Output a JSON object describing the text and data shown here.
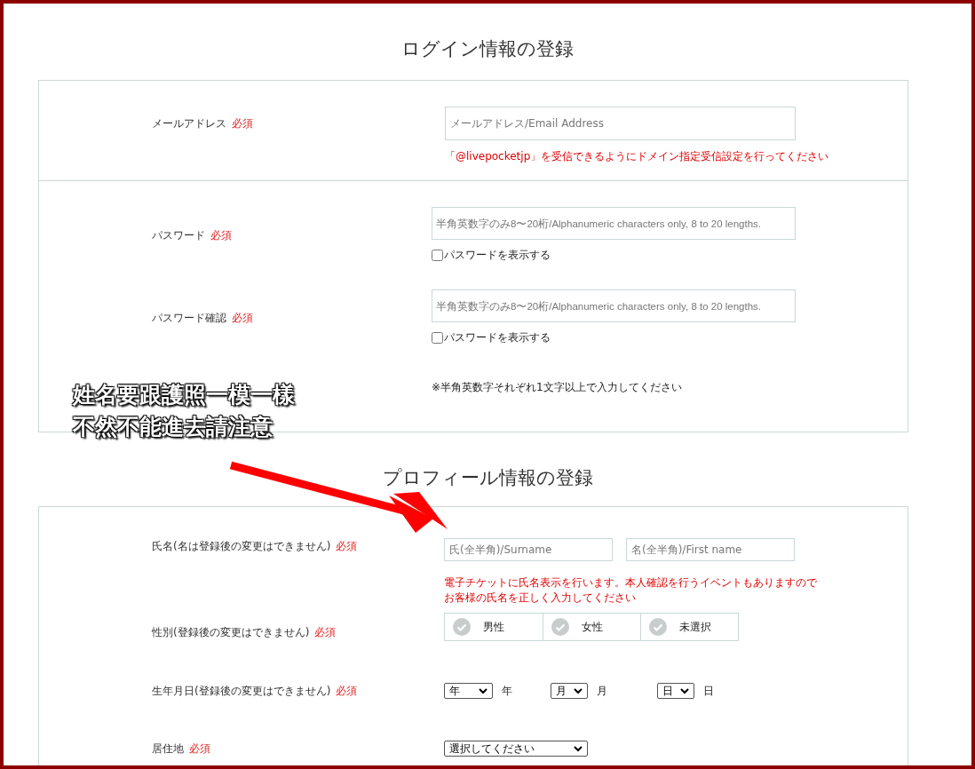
{
  "login_section": {
    "title": "ログイン情報の登録",
    "rows": [
      {
        "kind": "email",
        "label": "メールアドレス",
        "required": "必須",
        "placeholder": "メールアドレス/Email Address",
        "note": "「@livepocketjp」を受信できるようにドメイン指定受信設定を行ってください"
      },
      {
        "kind": "password",
        "label": "パスワード",
        "required": "必須",
        "placeholder": "半角英数字のみ8〜20桁/Alphanumeric characters only, 8 to 20 lengths.",
        "show_password": {
          "label": "パスワードを表示する",
          "checked": false
        }
      },
      {
        "kind": "password",
        "label": "パスワード確認",
        "required": "必須",
        "placeholder": "半角英数字のみ8〜20桁/Alphanumeric characters only, 8 to 20 lengths.",
        "show_password": {
          "label": "パスワードを表示する",
          "checked": false
        }
      },
      {
        "kind": "note",
        "text": "※半角英数字それぞれ1文字以上で入力してください"
      }
    ]
  },
  "profile_section": {
    "title": "プロフィール情報の登録",
    "rows": [
      {
        "kind": "name",
        "label": "氏名(名は登録後の変更はできません)",
        "required": "必須",
        "placeholders": [
          "氏(全半角)/Surname",
          "名(全半角)/First name"
        ],
        "note_lines": [
          "電子チケットに氏名表示を行います。本人確認を行うイベントもありますので",
          "お客様の氏名を正しく入力してください"
        ]
      },
      {
        "kind": "gender",
        "label": "性別(登録後の変更はできません)",
        "required": "必須",
        "options": [
          {
            "label": "男性",
            "selected": false
          },
          {
            "label": "女性",
            "selected": false
          },
          {
            "label": "未選択",
            "selected": false
          }
        ]
      },
      {
        "kind": "date",
        "label": "生年月日(登録後の変更はできません)",
        "required": "必須",
        "selects": [
          {
            "value": "年",
            "unit": "年"
          },
          {
            "value": "月",
            "unit": "月"
          },
          {
            "value": "日",
            "unit": "日"
          }
        ]
      },
      {
        "kind": "select",
        "label": "居住地",
        "required": "必須",
        "value": "選択してください"
      }
    ]
  },
  "annotation": {
    "lines": [
      "姓名要跟護照一模一樣",
      "不然不能進去請注意"
    ]
  }
}
